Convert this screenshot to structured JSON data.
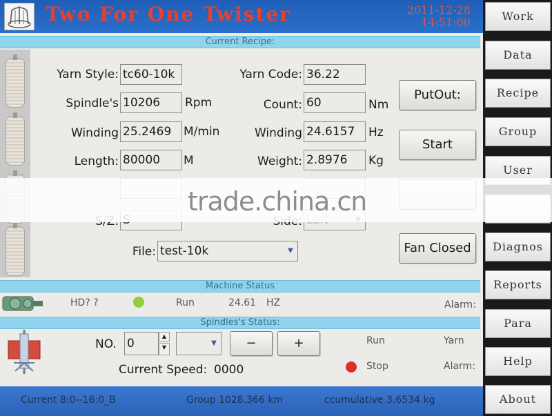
{
  "app": {
    "title": "Two For One Twister",
    "date": "2011-12-28",
    "time": "14:51:00"
  },
  "sections": {
    "recipe": "Current Recipe:",
    "machine": "Machine Status",
    "spindles": "Spindles's Status:"
  },
  "recipe": {
    "yarn_style_label": "Yarn Style:",
    "yarn_style_value": "tc60-10k",
    "yarn_code_label": "Yarn Code:",
    "yarn_code_value": "36.22",
    "spindle_label": "Spindle's",
    "spindle_value": "10206",
    "spindle_unit": "Rpm",
    "count_label": "Count:",
    "count_value": "60",
    "count_unit": "Nm",
    "winding1_label": "Winding",
    "winding1_value": "25.2469",
    "winding1_unit": "M/min",
    "winding2_label": "Winding",
    "winding2_value": "24.6157",
    "winding2_unit": "Hz",
    "length_label": "Length:",
    "length_value": "80000",
    "length_unit": "M",
    "weight_label": "Weight:",
    "weight_value": "2.8976",
    "weight_unit": "Kg",
    "sz_label": "S/Z:",
    "sz_value": "S",
    "side_label": "Side:",
    "side_value": "Left",
    "file_label": "File:",
    "file_value": "test-10k"
  },
  "buttons": {
    "putout": "PutOut:",
    "start": "Start",
    "fan": "Fan Closed",
    "minus": "−",
    "plus": "+"
  },
  "machine_status": {
    "hd": "HD? ?",
    "run": "Run",
    "freq": "24.61",
    "freq_unit": "HZ",
    "alarm": "Alarm:",
    "run_color": "#8fd13a"
  },
  "spindle_status": {
    "no_label": "NO.",
    "no_value": "0",
    "current_speed_label": "Current Speed:",
    "current_speed_value": "0000",
    "run": "Run",
    "yarn": "Yarn",
    "stop": "Stop",
    "alarm": "Alarm:",
    "stop_color": "#d9302a"
  },
  "footer": {
    "current": "Current 8:0--16:0_B",
    "group": "Group  1028.366 km",
    "cumulative": "ccumulative  3.6534 kg"
  },
  "nav": [
    "Work",
    "Data",
    "Recipe",
    "Group",
    "User",
    "Diagnos",
    "Reports",
    "Para",
    "Help",
    "About"
  ],
  "watermark": "trade.china.cn"
}
